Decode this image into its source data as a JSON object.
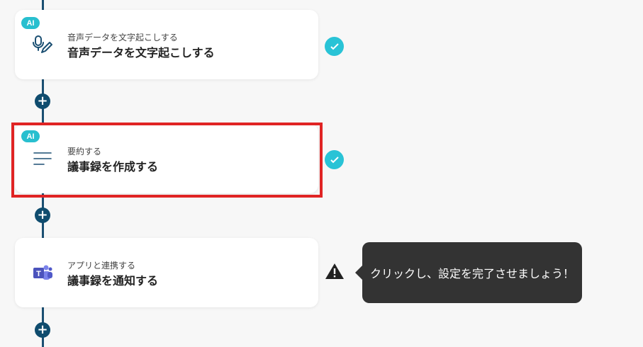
{
  "colors": {
    "flow_line": "#1b4f72",
    "add_button": "#0f4c6e",
    "ai_badge": "#28bfcf",
    "check": "#29c3d6",
    "highlight": "#e02424",
    "tooltip_bg": "#333333"
  },
  "steps": [
    {
      "badge": "AI",
      "icon": "microphone-pen-icon",
      "subtitle": "音声データを文字起こしする",
      "title": "音声データを文字起こしする",
      "status": "check-icon"
    },
    {
      "badge": "AI",
      "icon": "lines-icon",
      "subtitle": "要約する",
      "title": "議事録を作成する",
      "status": "check-icon",
      "highlighted": true
    },
    {
      "icon": "teams-icon",
      "subtitle": "アプリと連携する",
      "title": "議事録を通知する",
      "status": "warning-icon"
    }
  ],
  "add_button_symbol": "+",
  "tooltip": {
    "text": "クリックし、設定を完了させましょう！"
  }
}
